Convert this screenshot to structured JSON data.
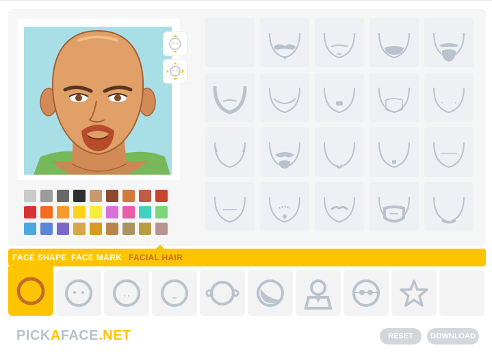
{
  "tabs": [
    {
      "label": "FACE SHAPE",
      "active": false
    },
    {
      "label": "FACE MARK",
      "active": false
    },
    {
      "label": "FACIAL HAIR",
      "active": true
    }
  ],
  "logo": {
    "part1": "PICK",
    "part2": "A",
    "part3": "FACE",
    "part4": ".NET"
  },
  "buttons": {
    "reset": "RESET",
    "download": "DOWNLOAD"
  },
  "colors": {
    "accent": "#ffc400",
    "active_tab_text": "#c46b2b",
    "icon_gray": "#b9c2cd",
    "preview_bg": "#a8dfe6"
  },
  "palette": [
    [
      "#c9c9c9",
      "#9b9b9b",
      "#686868",
      "#2f2f2f",
      "#c79a6c",
      "#8b4a2b",
      "#d27a3c",
      "#c05c44",
      "#c7462b"
    ],
    [
      "#d93232",
      "#f36b1c",
      "#f79a2c",
      "#ffd21a",
      "#f6ed3b",
      "#da71d8",
      "#e85ba7",
      "#3fd3bf",
      "#7ed67a"
    ],
    [
      "#49a8dd",
      "#5a87d8",
      "#7a6ac6",
      "#d7a74a",
      "#d79a1e",
      "#b8864b",
      "#a8955f",
      "#b89e3f",
      "#b89491"
    ]
  ],
  "facial_hair_grid": [
    "none",
    "mustache-wide",
    "mustache-thin",
    "chin-patch-wide",
    "full-goatee",
    "chinstrap",
    "thin-chinstrap",
    "soul-patch",
    "chin-frame",
    "mutton-dots",
    "sideburns",
    "mustache-goatee",
    "chin-dot",
    "small-chin-patch",
    "lip-line",
    "plain-chin",
    "dotted-goatee",
    "curved-mustache",
    "circle-beard",
    "bottom-chin"
  ],
  "face_shapes": [
    "round-outline",
    "round-face",
    "dot-face",
    "line-face",
    "ears-face",
    "moon-face",
    "person-bust",
    "glasses-face",
    "star",
    "blank"
  ]
}
